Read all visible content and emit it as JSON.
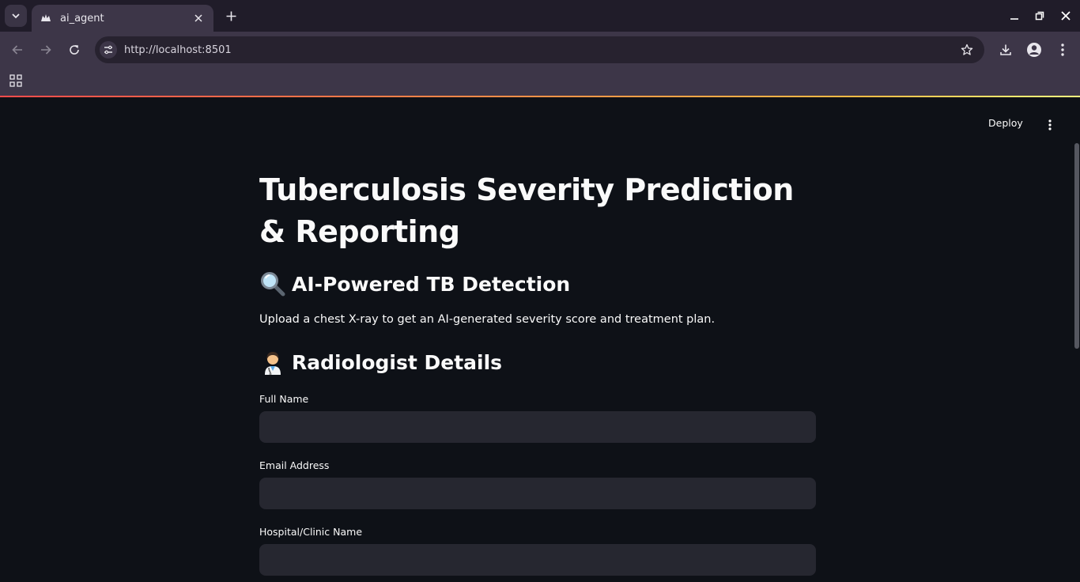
{
  "browser": {
    "tab_title": "ai_agent",
    "url": "http://localhost:8501"
  },
  "app": {
    "deploy_label": "Deploy",
    "title": "Tuberculosis Severity Prediction & Reporting",
    "detection_heading": "AI-Powered TB Detection",
    "description": "Upload a chest X-ray to get an AI-generated severity score and treatment plan.",
    "radiologist_heading": "Radiologist Details",
    "fields": [
      {
        "label": "Full Name",
        "value": "",
        "placeholder": ""
      },
      {
        "label": "Email Address",
        "value": "",
        "placeholder": ""
      },
      {
        "label": "Hospital/Clinic Name",
        "value": "",
        "placeholder": ""
      }
    ]
  },
  "colors": {
    "app_background": "#0e1117",
    "input_background": "#262730",
    "text": "#fafafa",
    "chrome_tab": "#3d3648",
    "chrome_frame": "#201c29"
  },
  "icons": [
    "tab-list-icon",
    "streamlit-favicon-icon",
    "close-icon",
    "plus-icon",
    "minimize-icon",
    "restore-icon",
    "window-close-icon",
    "back-arrow-icon",
    "forward-arrow-icon",
    "reload-icon",
    "site-info-icon",
    "star-icon",
    "download-icon",
    "profile-icon",
    "kebab-menu-icon",
    "apps-grid-icon",
    "magnifier-emoji-icon",
    "health-worker-emoji-icon"
  ]
}
